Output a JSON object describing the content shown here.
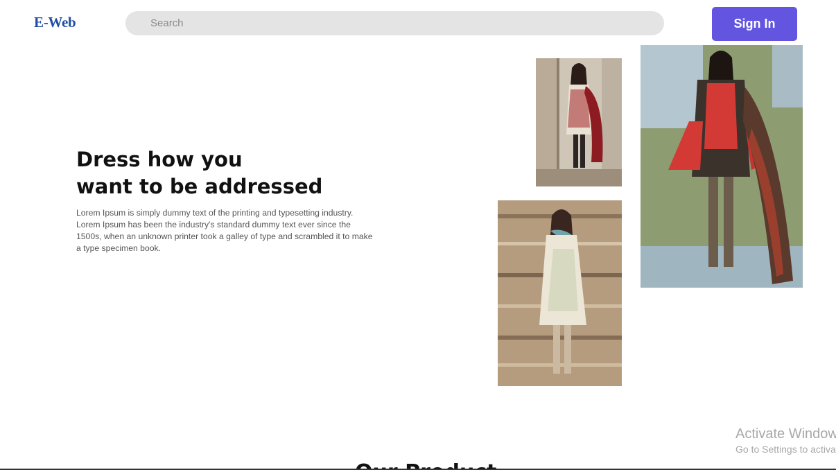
{
  "header": {
    "brand": "E-Web",
    "search_placeholder": "Search",
    "signin_label": "Sign In"
  },
  "hero": {
    "title_line1": "Dress how you",
    "title_line2": "want to be addressed",
    "body": "Lorem Ipsum is simply dummy text of the printing and typesetting industry. Lorem Ipsum has been the industry's standard dummy text ever since the 1500s, when an unknown printer took a galley of type and scrambled it to make a type specimen book."
  },
  "gallery": {
    "photos": [
      "model-printed-kurta-photo",
      "model-cream-embroidered-photo",
      "model-red-black-kurta-photo"
    ]
  },
  "next_section": {
    "heading": "Our Product"
  },
  "watermark": {
    "title": "Activate Windows",
    "subtitle": "Go to Settings to activate Windows."
  },
  "colors": {
    "brand": "#1f4fa3",
    "accent": "#6355e0",
    "search_bg": "#e4e4e4"
  }
}
